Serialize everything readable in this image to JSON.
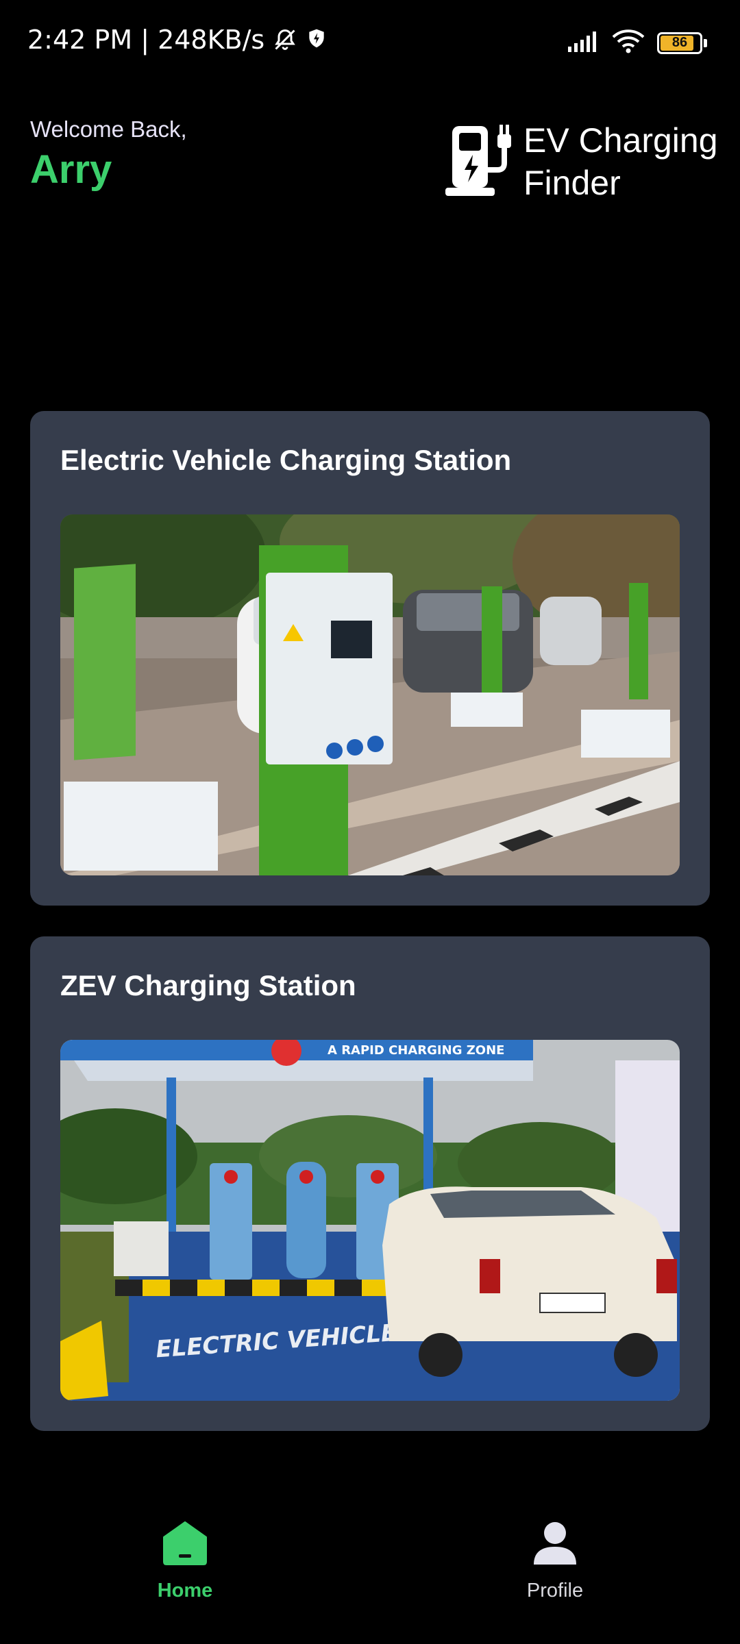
{
  "status_bar": {
    "time_speed": "2:42 PM | 248KB/s",
    "battery_level": "86",
    "icons": [
      "mute-bell-icon",
      "shield-bolt-icon",
      "signal-icon",
      "wifi-icon",
      "battery-icon"
    ]
  },
  "header": {
    "welcome": "Welcome Back,",
    "user_name": "Arry",
    "brand_line1": "EV Charging",
    "brand_line2": "Finder",
    "logo_icon": "ev-charger-icon"
  },
  "cards": [
    {
      "title": "Electric Vehicle Charging Station",
      "image": "ev-charging-station-photo"
    },
    {
      "title": "ZEV Charging Station",
      "image": "zev-charging-station-photo",
      "image_sign": "A RAPID CHARGING ZONE",
      "image_road_text": "ELECTRIC VEHICLE ONLY"
    }
  ],
  "nav": {
    "home_label": "Home",
    "profile_label": "Profile",
    "active": "Home"
  },
  "colors": {
    "accent": "#3ccf6c",
    "card_bg": "#363d4c",
    "background": "#000000"
  }
}
